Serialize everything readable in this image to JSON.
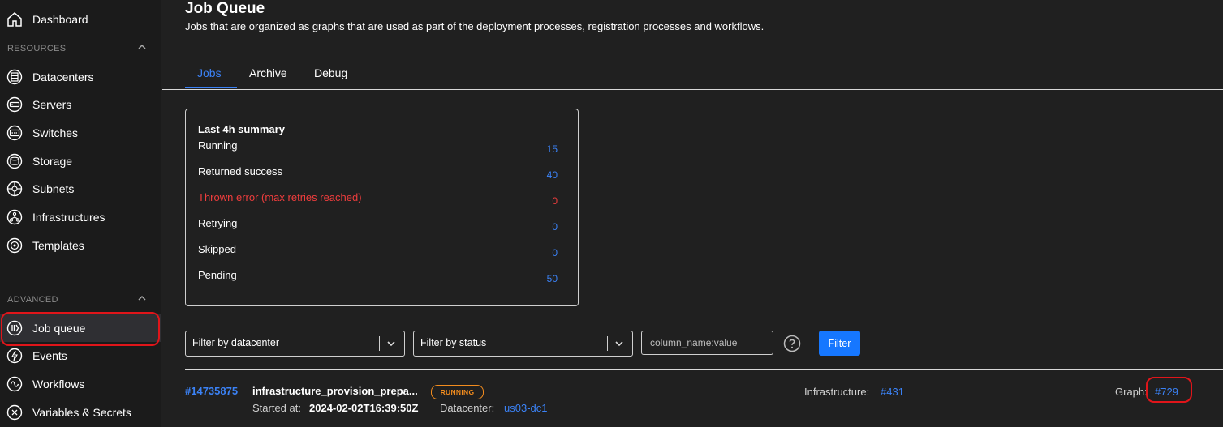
{
  "sidebar": {
    "dashboard": {
      "label": "Dashboard",
      "icon": "home-icon"
    },
    "sections": [
      {
        "label": "RESOURCES",
        "items": [
          {
            "label": "Datacenters",
            "icon": "datacenter-icon"
          },
          {
            "label": "Servers",
            "icon": "server-icon"
          },
          {
            "label": "Switches",
            "icon": "switch-icon"
          },
          {
            "label": "Storage",
            "icon": "storage-icon"
          },
          {
            "label": "Subnets",
            "icon": "subnet-icon"
          },
          {
            "label": "Infrastructures",
            "icon": "infrastructure-icon"
          },
          {
            "label": "Templates",
            "icon": "template-icon"
          }
        ]
      },
      {
        "label": "ADVANCED",
        "items": [
          {
            "label": "Job queue",
            "icon": "job-queue-icon",
            "active": true
          },
          {
            "label": "Events",
            "icon": "events-icon"
          },
          {
            "label": "Workflows",
            "icon": "workflow-icon"
          },
          {
            "label": "Variables & Secrets",
            "icon": "variables-icon"
          }
        ]
      }
    ]
  },
  "header": {
    "title": "Job Queue",
    "description": "Jobs that are organized as graphs that are used as part of the deployment processes, registration processes and workflows."
  },
  "tabs": [
    {
      "label": "Jobs",
      "active": true
    },
    {
      "label": "Archive"
    },
    {
      "label": "Debug"
    }
  ],
  "summary": {
    "title": "Last 4h summary",
    "rows": [
      {
        "label": "Running",
        "value": "15"
      },
      {
        "label": "Returned success",
        "value": "40"
      },
      {
        "label": "Thrown error (max retries reached)",
        "value": "0",
        "status": "error"
      },
      {
        "label": "Retrying",
        "value": "0"
      },
      {
        "label": "Skipped",
        "value": "0"
      },
      {
        "label": "Pending",
        "value": "50"
      }
    ]
  },
  "filters": {
    "datacenter_placeholder": "Filter by datacenter",
    "status_placeholder": "Filter by status",
    "query_placeholder": "column_name:value",
    "button_label": "Filter"
  },
  "job": {
    "id": "#14735875",
    "name": "infrastructure_provision_prepa...",
    "status": "RUNNING",
    "started_label": "Started at:",
    "started_value": "2024-02-02T16:39:50Z",
    "datacenter_label": "Datacenter:",
    "datacenter_value": "us03-dc1",
    "infrastructure_label": "Infrastructure:",
    "infrastructure_value": "#431",
    "graph_label": "Graph:",
    "graph_value": "#729"
  },
  "colors": {
    "accent": "#3b82f6",
    "error": "#ef3d3d",
    "running": "#f28c1e",
    "annotation": "#e0151a"
  }
}
